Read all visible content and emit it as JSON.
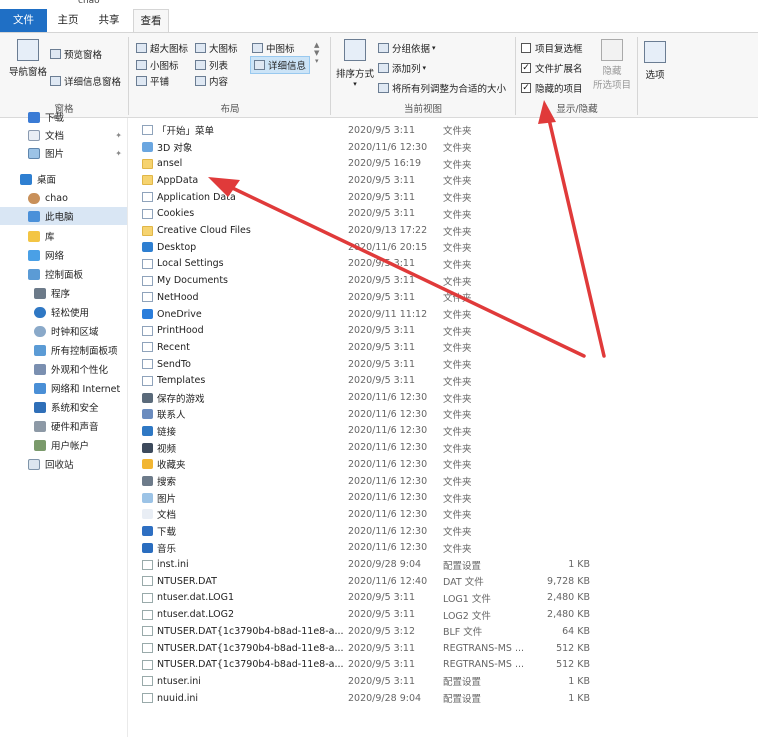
{
  "window": {
    "title": "chao"
  },
  "tabs": {
    "file": "文件",
    "home": "主页",
    "share": "共享",
    "view": "查看"
  },
  "ribbon": {
    "pane": {
      "nav_pane": "导航窗格",
      "preview_pane": "预览窗格",
      "details_pane": "详细信息窗格",
      "label": "窗格"
    },
    "layout": {
      "extra_large": "超大图标",
      "large": "大图标",
      "medium": "中图标",
      "small": "小图标",
      "list": "列表",
      "details": "详细信息",
      "tiles": "平铺",
      "content": "内容",
      "label": "布局"
    },
    "current_view": {
      "sort_by": "排序方式",
      "group_by": "分组依据",
      "add_columns": "添加列",
      "size_all_columns": "将所有列调整为合适的大小",
      "label": "当前视图"
    },
    "show_hide": {
      "item_checkboxes": "项目复选框",
      "file_extensions": "文件扩展名",
      "hidden_items": "隐藏的项目",
      "hide": "隐藏",
      "selected_items": "所选项目",
      "options": "选项",
      "label": "显示/隐藏",
      "checked": {
        "item_checkboxes": false,
        "file_extensions": true,
        "hidden_items": true
      }
    }
  },
  "sidebar": {
    "items": [
      {
        "label": "下载"
      },
      {
        "label": "文档"
      },
      {
        "label": "图片"
      },
      {
        "label": "桌面"
      },
      {
        "label": "chao"
      },
      {
        "label": "此电脑"
      },
      {
        "label": "库"
      },
      {
        "label": "网络"
      },
      {
        "label": "控制面板"
      },
      {
        "label": "程序"
      },
      {
        "label": "轻松使用"
      },
      {
        "label": "时钟和区域"
      },
      {
        "label": "所有控制面板项"
      },
      {
        "label": "外观和个性化"
      },
      {
        "label": "网络和 Internet"
      },
      {
        "label": "系统和安全"
      },
      {
        "label": "硬件和声音"
      },
      {
        "label": "用户帐户"
      },
      {
        "label": "回收站"
      }
    ]
  },
  "files": [
    {
      "name": "「开始」菜单",
      "date": "2020/9/5 3:11",
      "type": "文件夹",
      "size": "",
      "icon": "sys"
    },
    {
      "name": "3D 对象",
      "date": "2020/11/6 12:30",
      "type": "文件夹",
      "size": "",
      "icon": "3d"
    },
    {
      "name": "ansel",
      "date": "2020/9/5 16:19",
      "type": "文件夹",
      "size": "",
      "icon": "folder"
    },
    {
      "name": "AppData",
      "date": "2020/9/5 3:11",
      "type": "文件夹",
      "size": "",
      "icon": "folder"
    },
    {
      "name": "Application Data",
      "date": "2020/9/5 3:11",
      "type": "文件夹",
      "size": "",
      "icon": "sys"
    },
    {
      "name": "Cookies",
      "date": "2020/9/5 3:11",
      "type": "文件夹",
      "size": "",
      "icon": "sys"
    },
    {
      "name": "Creative Cloud Files",
      "date": "2020/9/13 17:22",
      "type": "文件夹",
      "size": "",
      "icon": "folder"
    },
    {
      "name": "Desktop",
      "date": "2020/11/6 20:15",
      "type": "文件夹",
      "size": "",
      "icon": "desktop"
    },
    {
      "name": "Local Settings",
      "date": "2020/9/5 3:11",
      "type": "文件夹",
      "size": "",
      "icon": "sys"
    },
    {
      "name": "My Documents",
      "date": "2020/9/5 3:11",
      "type": "文件夹",
      "size": "",
      "icon": "sys"
    },
    {
      "name": "NetHood",
      "date": "2020/9/5 3:11",
      "type": "文件夹",
      "size": "",
      "icon": "sys"
    },
    {
      "name": "OneDrive",
      "date": "2020/9/11 11:12",
      "type": "文件夹",
      "size": "",
      "icon": "cloud"
    },
    {
      "name": "PrintHood",
      "date": "2020/9/5 3:11",
      "type": "文件夹",
      "size": "",
      "icon": "sys"
    },
    {
      "name": "Recent",
      "date": "2020/9/5 3:11",
      "type": "文件夹",
      "size": "",
      "icon": "sys"
    },
    {
      "name": "SendTo",
      "date": "2020/9/5 3:11",
      "type": "文件夹",
      "size": "",
      "icon": "sys"
    },
    {
      "name": "Templates",
      "date": "2020/9/5 3:11",
      "type": "文件夹",
      "size": "",
      "icon": "sys"
    },
    {
      "name": "保存的游戏",
      "date": "2020/11/6 12:30",
      "type": "文件夹",
      "size": "",
      "icon": "game"
    },
    {
      "name": "联系人",
      "date": "2020/11/6 12:30",
      "type": "文件夹",
      "size": "",
      "icon": "contact"
    },
    {
      "name": "链接",
      "date": "2020/11/6 12:30",
      "type": "文件夹",
      "size": "",
      "icon": "link"
    },
    {
      "name": "视频",
      "date": "2020/11/6 12:30",
      "type": "文件夹",
      "size": "",
      "icon": "video"
    },
    {
      "name": "收藏夹",
      "date": "2020/11/6 12:30",
      "type": "文件夹",
      "size": "",
      "icon": "star"
    },
    {
      "name": "搜索",
      "date": "2020/11/6 12:30",
      "type": "文件夹",
      "size": "",
      "icon": "search"
    },
    {
      "name": "图片",
      "date": "2020/11/6 12:30",
      "type": "文件夹",
      "size": "",
      "icon": "pic"
    },
    {
      "name": "文档",
      "date": "2020/11/6 12:30",
      "type": "文件夹",
      "size": "",
      "icon": "doc"
    },
    {
      "name": "下载",
      "date": "2020/11/6 12:30",
      "type": "文件夹",
      "size": "",
      "icon": "download"
    },
    {
      "name": "音乐",
      "date": "2020/11/6 12:30",
      "type": "文件夹",
      "size": "",
      "icon": "music"
    },
    {
      "name": "inst.ini",
      "date": "2020/9/28 9:04",
      "type": "配置设置",
      "size": "1 KB",
      "icon": "file"
    },
    {
      "name": "NTUSER.DAT",
      "date": "2020/11/6 12:40",
      "type": "DAT 文件",
      "size": "9,728 KB",
      "icon": "file"
    },
    {
      "name": "ntuser.dat.LOG1",
      "date": "2020/9/5 3:11",
      "type": "LOG1 文件",
      "size": "2,480 KB",
      "icon": "file"
    },
    {
      "name": "ntuser.dat.LOG2",
      "date": "2020/9/5 3:11",
      "type": "LOG2 文件",
      "size": "2,480 KB",
      "icon": "file"
    },
    {
      "name": "NTUSER.DAT{1c3790b4-b8ad-11e8-a...",
      "date": "2020/9/5 3:12",
      "type": "BLF 文件",
      "size": "64 KB",
      "icon": "file"
    },
    {
      "name": "NTUSER.DAT{1c3790b4-b8ad-11e8-a...",
      "date": "2020/9/5 3:11",
      "type": "REGTRANS-MS ...",
      "size": "512 KB",
      "icon": "file"
    },
    {
      "name": "NTUSER.DAT{1c3790b4-b8ad-11e8-a...",
      "date": "2020/9/5 3:11",
      "type": "REGTRANS-MS ...",
      "size": "512 KB",
      "icon": "file"
    },
    {
      "name": "ntuser.ini",
      "date": "2020/9/5 3:11",
      "type": "配置设置",
      "size": "1 KB",
      "icon": "file"
    },
    {
      "name": "nuuid.ini",
      "date": "2020/9/28 9:04",
      "type": "配置设置",
      "size": "1 KB",
      "icon": "file"
    }
  ],
  "colors": {
    "accent": "#1f6fc5",
    "arrow": "#e03a3a",
    "folder": "#f6d36f"
  }
}
